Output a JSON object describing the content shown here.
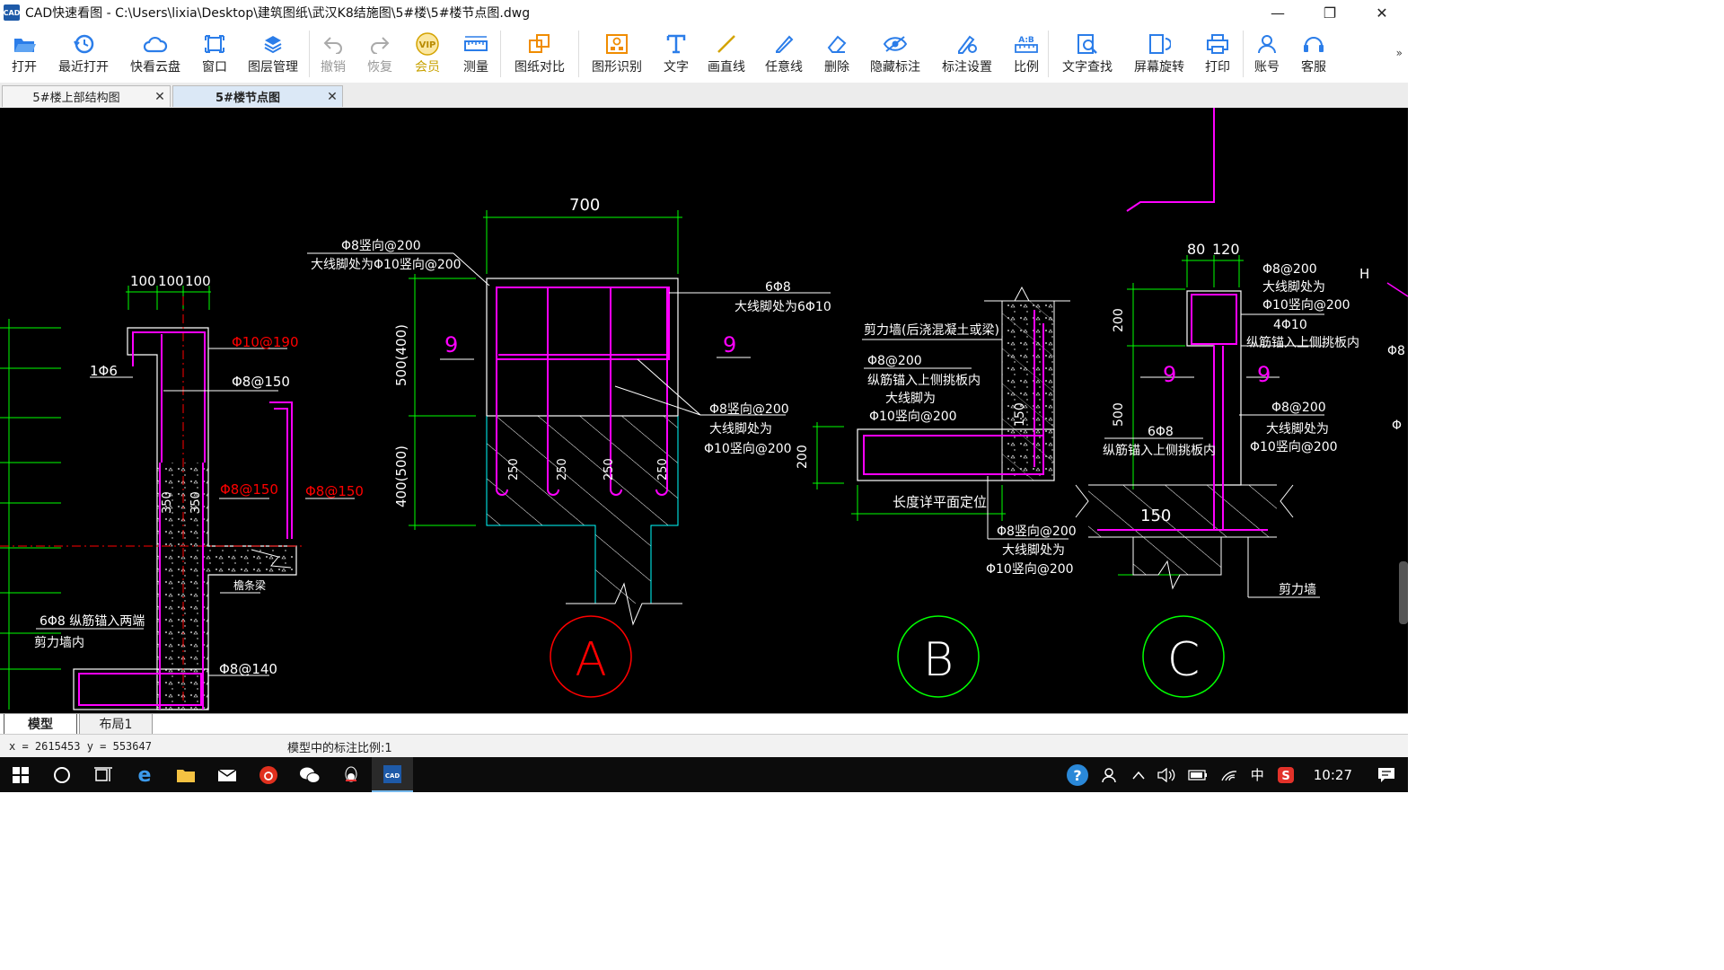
{
  "window": {
    "title": "CAD快速看图 - C:\\Users\\lixia\\Desktop\\建筑图纸\\武汉K8结施图\\5#楼\\5#楼节点图.dwg",
    "app_icon_text": "CAD",
    "controls": {
      "minimize": "—",
      "maximize": "❐",
      "close": "✕"
    }
  },
  "toolbar": {
    "items": [
      {
        "label": "打开",
        "icon": "open-folder-icon"
      },
      {
        "label": "最近打开",
        "icon": "recent-clock-icon"
      },
      {
        "label": "快看云盘",
        "icon": "cloud-icon"
      },
      {
        "label": "窗口",
        "icon": "window-icon"
      },
      {
        "label": "图层管理",
        "icon": "layers-icon"
      },
      {
        "label": "撤销",
        "icon": "undo-icon"
      },
      {
        "label": "恢复",
        "icon": "redo-icon"
      },
      {
        "label": "会员",
        "icon": "vip-icon",
        "badge": "VIP"
      },
      {
        "label": "测量",
        "icon": "measure-icon"
      },
      {
        "label": "图纸对比",
        "icon": "compare-icon"
      },
      {
        "label": "图形识别",
        "icon": "shape-recognition-icon"
      },
      {
        "label": "文字",
        "icon": "text-icon"
      },
      {
        "label": "画直线",
        "icon": "line-icon"
      },
      {
        "label": "任意线",
        "icon": "freehand-icon"
      },
      {
        "label": "删除",
        "icon": "eraser-icon"
      },
      {
        "label": "隐藏标注",
        "icon": "hide-annotation-icon"
      },
      {
        "label": "标注设置",
        "icon": "annotation-settings-icon"
      },
      {
        "label": "比例",
        "icon": "scale-icon",
        "badge": "A:B"
      },
      {
        "label": "文字查找",
        "icon": "text-search-icon"
      },
      {
        "label": "屏幕旋转",
        "icon": "rotate-screen-icon"
      },
      {
        "label": "打印",
        "icon": "printer-icon"
      },
      {
        "label": "账号",
        "icon": "account-icon"
      },
      {
        "label": "客服",
        "icon": "headset-icon"
      }
    ],
    "more": "»"
  },
  "tabs": [
    {
      "label": "5#楼上部结构图",
      "active": false
    },
    {
      "label": "5#楼节点图",
      "active": true
    }
  ],
  "tab_close": "✕",
  "drawing": {
    "left_detail": {
      "dims_top": [
        "100",
        "100",
        "100"
      ],
      "labels": [
        "1Φ6",
        "Φ8@150",
        "350",
        "350",
        "檐条梁",
        "6Φ8  纵筋锚入两端",
        "剪力墙内",
        "Φ8@140"
      ],
      "red_labels": [
        "Φ10@190",
        "Φ8@150",
        "Φ8@150"
      ]
    },
    "detail_a": {
      "dim_top": "700",
      "notes": [
        "Φ8竖向@200",
        "大线脚处为Φ10竖向@200",
        "6Φ8",
        "大线脚处为6Φ10",
        "Φ8竖向@200",
        "大线脚处为",
        "Φ10竖向@200"
      ],
      "dims_side": [
        "500(400)",
        "400(500)"
      ],
      "rebar_dims": [
        "250",
        "250",
        "250",
        "250"
      ],
      "section_marks": [
        "9",
        "9"
      ],
      "circle_label": "A"
    },
    "detail_b": {
      "notes": [
        "剪力墙(后浇混凝土或梁)",
        "Φ8@200",
        "纵筋锚入上侧挑板内",
        "大线脚为",
        "Φ10竖向@200",
        "长度详平面定位",
        "Φ8竖向@200",
        "大线脚处为",
        "Φ10竖向@200"
      ],
      "dims": [
        "200",
        "150"
      ],
      "circle_label": "B"
    },
    "detail_c": {
      "dims_top": [
        "80",
        "120"
      ],
      "notes": [
        "Φ8@200",
        "大线脚处为",
        "Φ10竖向@200",
        "4Φ10",
        "纵筋锚入上侧挑板内",
        "6Φ8",
        "纵筋锚入上侧挑板内",
        "Φ8@200",
        "大线脚处为",
        "Φ10竖向@200",
        "剪力墙"
      ],
      "dims_side": [
        "200",
        "500"
      ],
      "dim_bottom": "150",
      "section_marks": [
        "9",
        "9"
      ],
      "circle_label": "C"
    },
    "edge_labels": [
      "H",
      "Φ8",
      "Φ"
    ]
  },
  "layout_tabs": [
    {
      "label": "模型",
      "active": true
    },
    {
      "label": "布局1",
      "active": false
    }
  ],
  "status": {
    "coords": "x = 2615453  y = 553647",
    "scale_text": "模型中的标注比例:1"
  },
  "taskbar": {
    "time": "10:27",
    "ime": "中",
    "help": "?"
  },
  "colors": {
    "canvas_bg": "#000000",
    "line_white": "#ffffff",
    "rebar_magenta": "#ff00ff",
    "dim_green": "#00ff00",
    "label_red": "#ff0000",
    "cyan": "#00ffff"
  }
}
